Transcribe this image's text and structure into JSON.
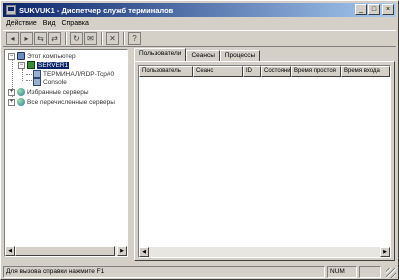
{
  "window": {
    "title": "SUKVUK1 - Диспетчер служб терминалов",
    "buttons": {
      "minimize": "_",
      "maximize": "□",
      "close": "×"
    }
  },
  "menu": [
    "Действие",
    "Вид",
    "Справка",
    "Справка"
  ],
  "toolbar": {
    "icons": [
      "back-icon",
      "forward-icon",
      "connect-icon",
      "disconnect-icon",
      "refresh-icon",
      "message-icon",
      "reset-icon",
      "help-icon"
    ]
  },
  "tree": {
    "root": "Этот компьютер",
    "server": "SERVER1",
    "session1": "ТЕРМИНАЛ/RDP-Tcp#0",
    "session2": "Console",
    "domains": "Избранные серверы",
    "all_servers": "Все перечисленные серверы"
  },
  "tabs": [
    "Пользователи",
    "Сеансы",
    "Процессы"
  ],
  "columns": [
    "Пользователь",
    "Сеанс",
    "ID",
    "Состояние",
    "Время простоя",
    "Время входа"
  ],
  "status": {
    "message": "Для вызова справки нажмите F1",
    "indicator": "NUM"
  }
}
